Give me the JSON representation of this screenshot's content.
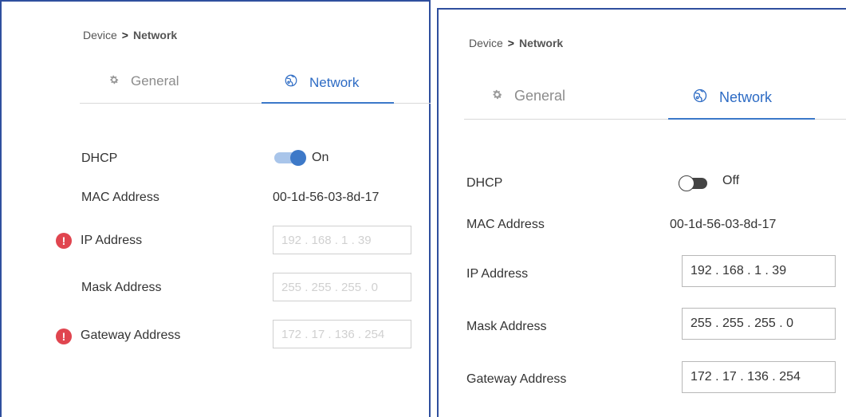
{
  "panel_a": {
    "breadcrumb": {
      "parent": "Device",
      "separator": ">",
      "current": "Network"
    },
    "tabs": [
      {
        "label": "General",
        "icon": "gear-icon",
        "active": false
      },
      {
        "label": "Network",
        "icon": "globe-network-icon",
        "active": true
      }
    ],
    "dhcp": {
      "label": "DHCP",
      "state": "On"
    },
    "mac": {
      "label": "MAC Address",
      "value": "00-1d-56-03-8d-17"
    },
    "ip": {
      "label": "IP Address",
      "value": "192 . 168 .   1   .  39",
      "error": true
    },
    "mask": {
      "label": "Mask Address",
      "value": "255 . 255 . 255 .  0",
      "error": false
    },
    "gateway": {
      "label": "Gateway Address",
      "value": "172 .  17  . 136 . 254",
      "error": true
    },
    "error_glyph": "!"
  },
  "panel_b": {
    "breadcrumb": {
      "parent": "Device",
      "separator": ">",
      "current": "Network"
    },
    "tabs": [
      {
        "label": "General",
        "icon": "gear-icon",
        "active": false
      },
      {
        "label": "Network",
        "icon": "globe-network-icon",
        "active": true
      }
    ],
    "dhcp": {
      "label": "DHCP",
      "state": "Off"
    },
    "mac": {
      "label": "MAC Address",
      "value": "00-1d-56-03-8d-17"
    },
    "ip": {
      "label": "IP Address",
      "value": "192 . 168 .   1   .  39"
    },
    "mask": {
      "label": "Mask Address",
      "value": "255 . 255 . 255 .  0"
    },
    "gateway": {
      "label": "Gateway Address",
      "value": "172 .  17  . 136 . 254"
    }
  },
  "colors": {
    "accent": "#2d6bc4",
    "error": "#e0454f",
    "frame": "#2f4f9e"
  }
}
